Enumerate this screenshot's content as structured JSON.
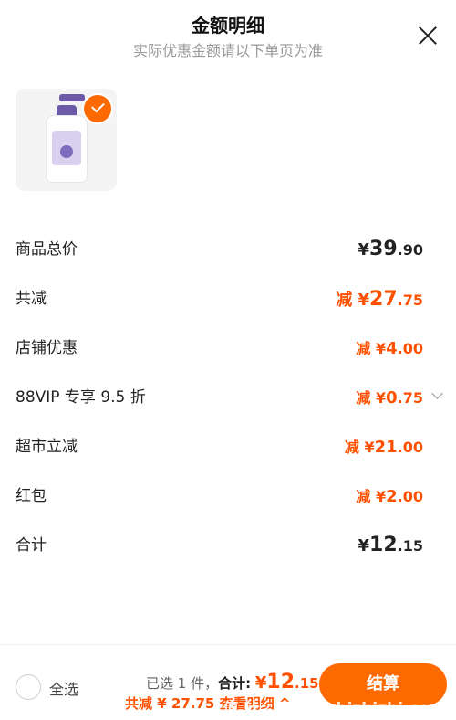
{
  "header": {
    "title": "金额明细",
    "subtitle": "实际优惠金额请以下单页为准"
  },
  "items": [
    {
      "label": "商品总价",
      "prefix": "",
      "yen": "¥",
      "int": "39",
      "dec": ".90",
      "color": "#222222"
    },
    {
      "label": "共减",
      "prefix": "减 ",
      "yen": "¥",
      "int": "27",
      "dec": ".75",
      "color": "#ff5000"
    },
    {
      "label": "店铺优惠",
      "prefix": "减 ",
      "yen": "¥",
      "int": "4",
      "dec": ".00",
      "color": "#ff5000"
    },
    {
      "label": "88VIP 专享 9.5 折",
      "prefix": "减 ",
      "yen": "¥",
      "int": "0",
      "dec": ".75",
      "color": "#ff5000"
    },
    {
      "label": "超市立减",
      "prefix": "减 ",
      "yen": "¥",
      "int": "21",
      "dec": ".00",
      "color": "#ff5000"
    },
    {
      "label": "红包",
      "prefix": "减 ",
      "yen": "¥",
      "int": "2",
      "dec": ".00",
      "color": "#ff5000"
    },
    {
      "label": "合计",
      "prefix": "",
      "yen": "¥",
      "int": "12",
      "dec": ".15",
      "color": "#222222"
    }
  ],
  "footer": {
    "select_all": "全选",
    "selected_text": "已选 1 件，",
    "total_label": "合计:",
    "total_yen": "¥",
    "total_int": "12",
    "total_dec": ".15",
    "savings_text": "共减 ¥ 27.75",
    "details_link": "查看明细",
    "details_caret": "^",
    "checkout": "结算",
    "watermark": "值 什么值得买 zhizhizhi.com"
  },
  "colors": {
    "accent": "#ff5000",
    "button": "#ff6a00"
  }
}
